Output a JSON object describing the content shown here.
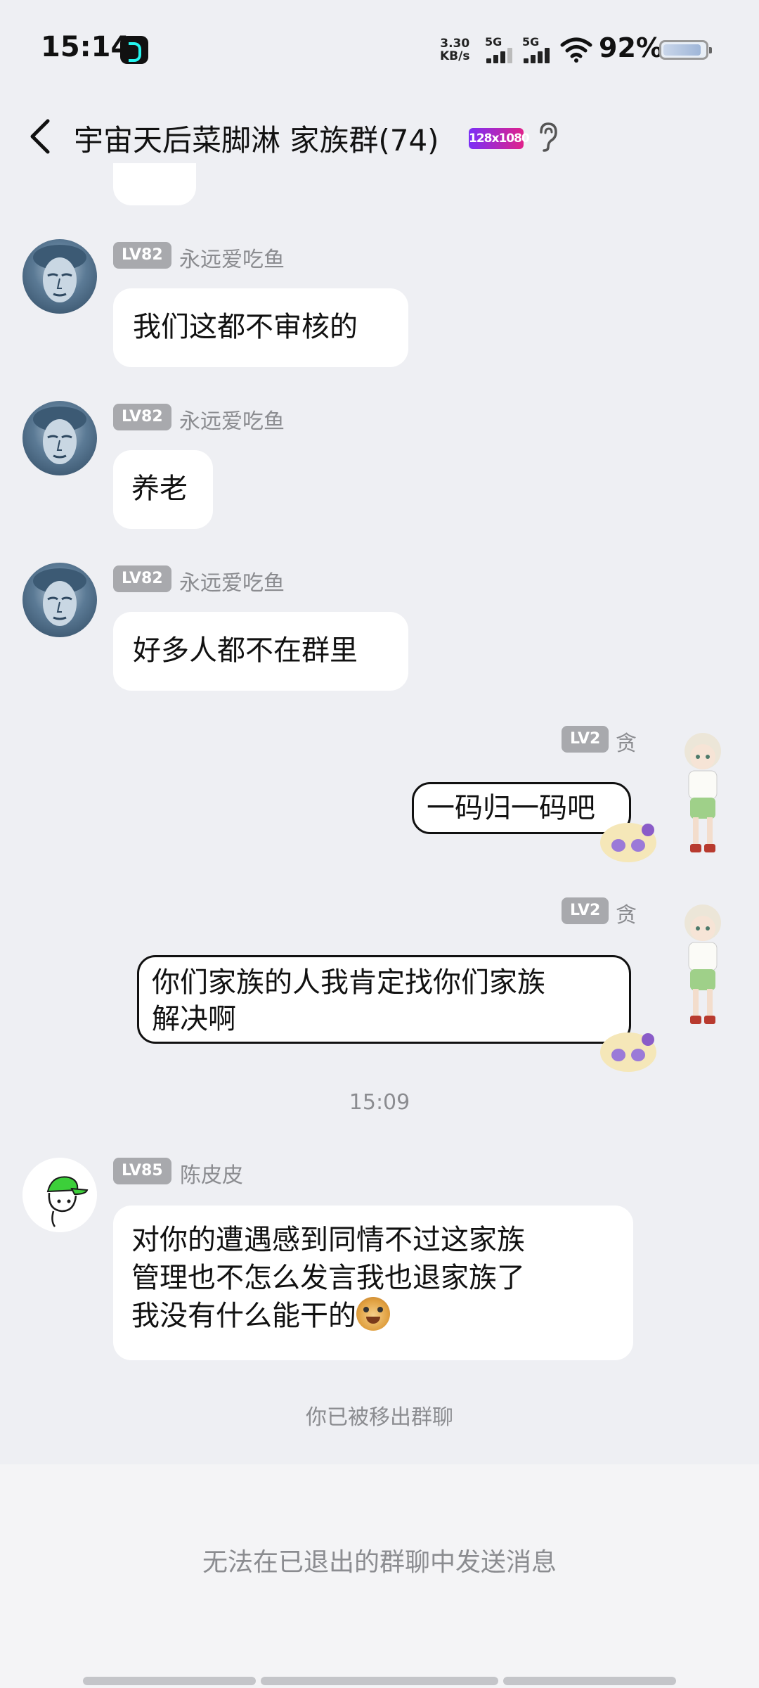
{
  "status_bar": {
    "time": "15:14",
    "net_speed_value": "3.30",
    "net_speed_unit": "KB/s",
    "sim1_label": "5G",
    "sim2_label": "5G",
    "battery_percent": "92%",
    "battery_level": 0.92,
    "app_icon": "tiktok-icon"
  },
  "header": {
    "back_icon": "chevron-left-icon",
    "title": "宇宙天后菜脚淋 家族群(74)",
    "badge_text": "128x1080",
    "earpiece_icon": "ear-icon"
  },
  "messages": [
    {
      "level": "LV82",
      "name": "永远爱吃鱼",
      "text": "我们这都不审核的"
    },
    {
      "level": "LV82",
      "name": "永远爱吃鱼",
      "text": "养老"
    },
    {
      "level": "LV82",
      "name": "永远爱吃鱼",
      "text": "好多人都不在群里"
    },
    {
      "level": "LV2",
      "name": "贪",
      "text": "一码归一码吧"
    },
    {
      "level": "LV2",
      "name": "贪",
      "text_line1": "你们家族的人我肯定找你们家族",
      "text_line2": "解决啊"
    },
    {
      "level": "LV85",
      "name": "陈皮皮",
      "text_line1": "对你的遭遇感到同情不过这家族",
      "text_line2": "管理也不怎么发言我也退家族了",
      "text_line3": "我没有什么能干的",
      "emoji": "dog-emoji"
    }
  ],
  "timestamp": "15:09",
  "system_message": "你已被移出群聊",
  "bottom_notice": "无法在已退出的群聊中发送消息",
  "colors": {
    "background": "#eeeff3",
    "bubble": "#ffffff",
    "level_badge": "#a8a9ad",
    "muted_text": "#8b8c90"
  }
}
